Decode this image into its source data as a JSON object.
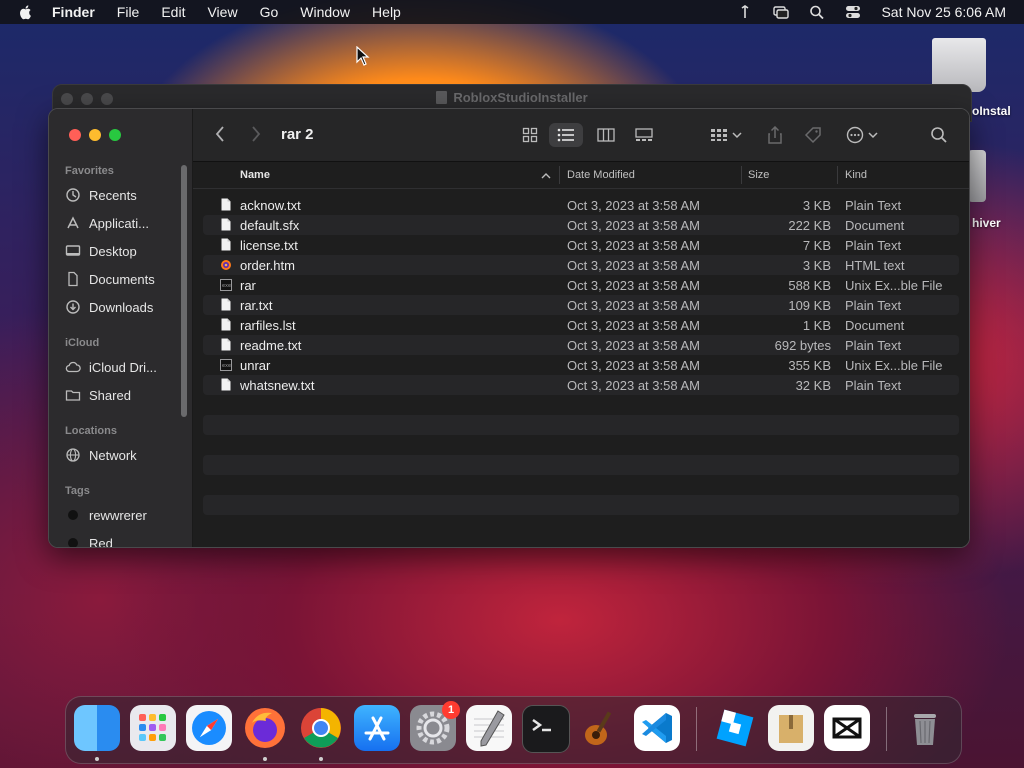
{
  "menubar": {
    "app": "Finder",
    "items": [
      "File",
      "Edit",
      "View",
      "Go",
      "Window",
      "Help"
    ],
    "clock": "Sat Nov 25  6:06 AM"
  },
  "desktop": {
    "items": [
      {
        "label": "oInstal"
      },
      {
        "label": "hiver"
      }
    ]
  },
  "background_window": {
    "title": "RobloxStudioInstaller"
  },
  "finder": {
    "folder": "rar 2",
    "sidebar": {
      "favorites_title": "Favorites",
      "favorites": [
        "Recents",
        "Applicati...",
        "Desktop",
        "Documents",
        "Downloads"
      ],
      "icloud_title": "iCloud",
      "icloud": [
        "iCloud Dri...",
        "Shared"
      ],
      "locations_title": "Locations",
      "locations": [
        "Network"
      ],
      "tags_title": "Tags",
      "tags": [
        {
          "label": "rewwrerer",
          "color": "#111111"
        },
        {
          "label": "Red",
          "color": "#111111"
        }
      ]
    },
    "columns": {
      "name": "Name",
      "date": "Date Modified",
      "size": "Size",
      "kind": "Kind"
    },
    "files": [
      {
        "name": "acknow.txt",
        "date": "Oct 3, 2023 at 3:58 AM",
        "size": "3 KB",
        "kind": "Plain Text",
        "icon": "text-file-icon"
      },
      {
        "name": "default.sfx",
        "date": "Oct 3, 2023 at 3:58 AM",
        "size": "222 KB",
        "kind": "Document",
        "icon": "document-file-icon"
      },
      {
        "name": "license.txt",
        "date": "Oct 3, 2023 at 3:58 AM",
        "size": "7 KB",
        "kind": "Plain Text",
        "icon": "text-file-icon"
      },
      {
        "name": "order.htm",
        "date": "Oct 3, 2023 at 3:58 AM",
        "size": "3 KB",
        "kind": "HTML text",
        "icon": "html-file-icon"
      },
      {
        "name": "rar",
        "date": "Oct 3, 2023 at 3:58 AM",
        "size": "588 KB",
        "kind": "Unix Ex...ble File",
        "icon": "executable-file-icon"
      },
      {
        "name": "rar.txt",
        "date": "Oct 3, 2023 at 3:58 AM",
        "size": "109 KB",
        "kind": "Plain Text",
        "icon": "text-file-icon"
      },
      {
        "name": "rarfiles.lst",
        "date": "Oct 3, 2023 at 3:58 AM",
        "size": "1 KB",
        "kind": "Document",
        "icon": "document-file-icon"
      },
      {
        "name": "readme.txt",
        "date": "Oct 3, 2023 at 3:58 AM",
        "size": "692 bytes",
        "kind": "Plain Text",
        "icon": "text-file-icon"
      },
      {
        "name": "unrar",
        "date": "Oct 3, 2023 at 3:58 AM",
        "size": "355 KB",
        "kind": "Unix Ex...ble File",
        "icon": "executable-file-icon"
      },
      {
        "name": "whatsnew.txt",
        "date": "Oct 3, 2023 at 3:58 AM",
        "size": "32 KB",
        "kind": "Plain Text",
        "icon": "text-file-icon"
      }
    ]
  },
  "dock": {
    "settings_badge": "1",
    "apps": [
      "finder-icon",
      "launchpad-icon",
      "safari-icon",
      "firefox-icon",
      "chrome-icon",
      "app-store-icon",
      "system-settings-icon",
      "textedit-icon",
      "terminal-icon",
      "garageband-icon",
      "vscode-icon",
      "roblox-studio-icon",
      "archive-utility-icon",
      "capcut-icon",
      "trash-icon"
    ]
  }
}
